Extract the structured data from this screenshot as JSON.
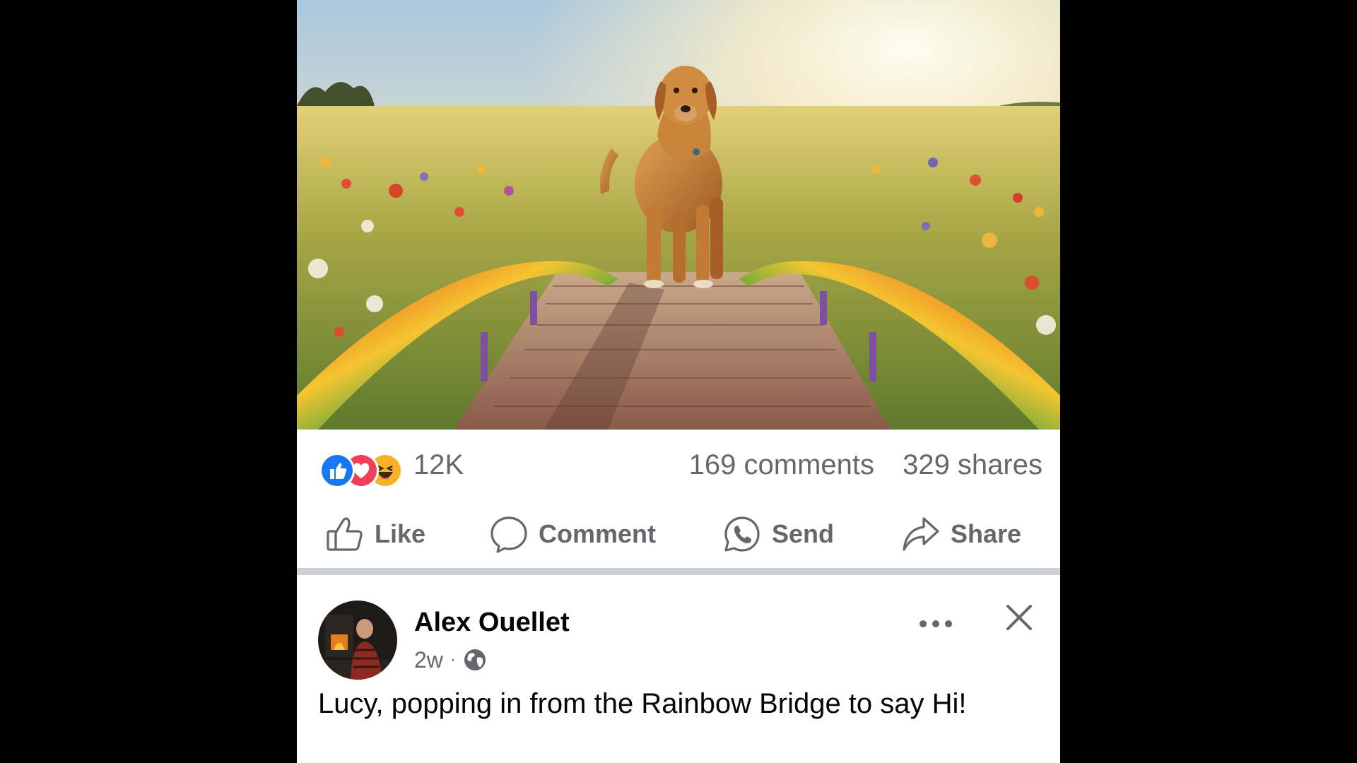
{
  "post": {
    "image": {
      "icon": "dog-on-rainbow-bridge-photo",
      "colors": {
        "sky": "#f3e7c9",
        "field": "#c9b048",
        "bridge": "#9a6a58",
        "dog": "#c8823a"
      }
    },
    "stats": {
      "reactions": [
        "like",
        "love",
        "haha"
      ],
      "reaction_count": "12K",
      "comments": "169 comments",
      "shares": "329 shares"
    },
    "actions": {
      "like": "Like",
      "comment": "Comment",
      "send": "Send",
      "share": "Share"
    }
  },
  "next_post": {
    "author": "Alex Ouellet",
    "time": "2w",
    "separator": "·",
    "audience_icon": "globe-icon",
    "text": "Lucy, popping in from the Rainbow Bridge to say Hi!"
  },
  "colors": {
    "like_blue": "#1877f2",
    "love_red": "#f33e58",
    "haha_yellow": "#f7b125",
    "secondary_text": "#65676b",
    "divider": "#cdd0d4"
  }
}
